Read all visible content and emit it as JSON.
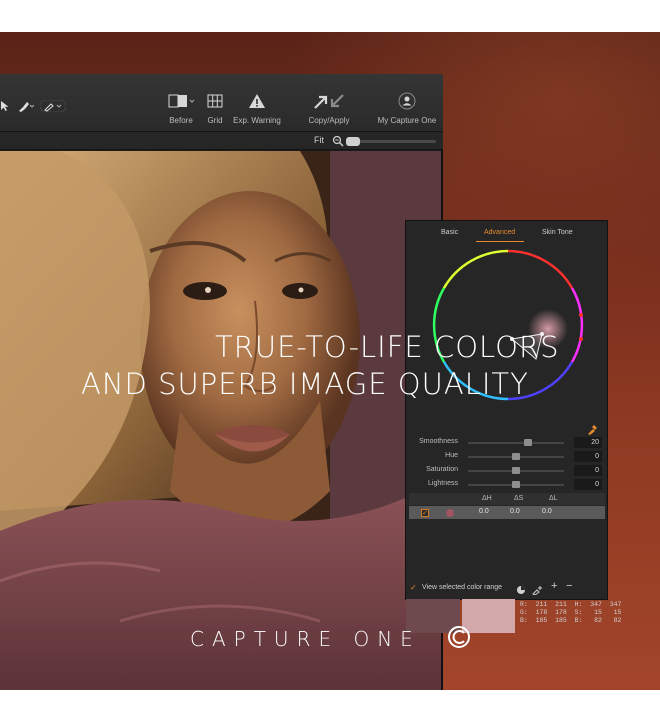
{
  "toolbar": {
    "tools": [
      {
        "label": "Before"
      },
      {
        "label": "Grid"
      },
      {
        "label": "Exp. Warning"
      },
      {
        "label": "Copy/Apply"
      },
      {
        "label": "My Capture One"
      }
    ],
    "fit_label": "Fit"
  },
  "panel": {
    "tabs": [
      "Basic",
      "Advanced",
      "Skin Tone"
    ],
    "active_tab": "Advanced",
    "sliders": [
      {
        "label": "Smoothness",
        "value": "20",
        "level": 0.63
      },
      {
        "label": "Hue",
        "value": "0",
        "level": 0.5
      },
      {
        "label": "Saturation",
        "value": "0",
        "level": 0.5
      },
      {
        "label": "Lightness",
        "value": "0",
        "level": 0.5
      }
    ],
    "delta_headers": [
      "ΔH",
      "ΔS",
      "ΔL"
    ],
    "range_row": {
      "dh": "0.0",
      "ds": "0.0",
      "dl": "0.0",
      "swatch_color": "#a05462"
    },
    "view_selected_label": "View selected color range",
    "swatches": {
      "before": "#6e4a4f",
      "after": "#d3a8ab"
    },
    "readout": {
      "r": "R:  211  211",
      "g": "G:  178  178",
      "b": "B:  185  185",
      "h": "H:  347  347",
      "s": "S:   15   15",
      "bb": "B:   82   82"
    }
  },
  "headline": {
    "line1": "TRUE-TO-LIFE COLORS",
    "line2": "AND SUPERB IMAGE QUALITY"
  },
  "brand": "CAPTURE ONE",
  "colors": {
    "accent": "#e88b2d",
    "panel_bg": "#262626",
    "background": "#8e3a22"
  }
}
